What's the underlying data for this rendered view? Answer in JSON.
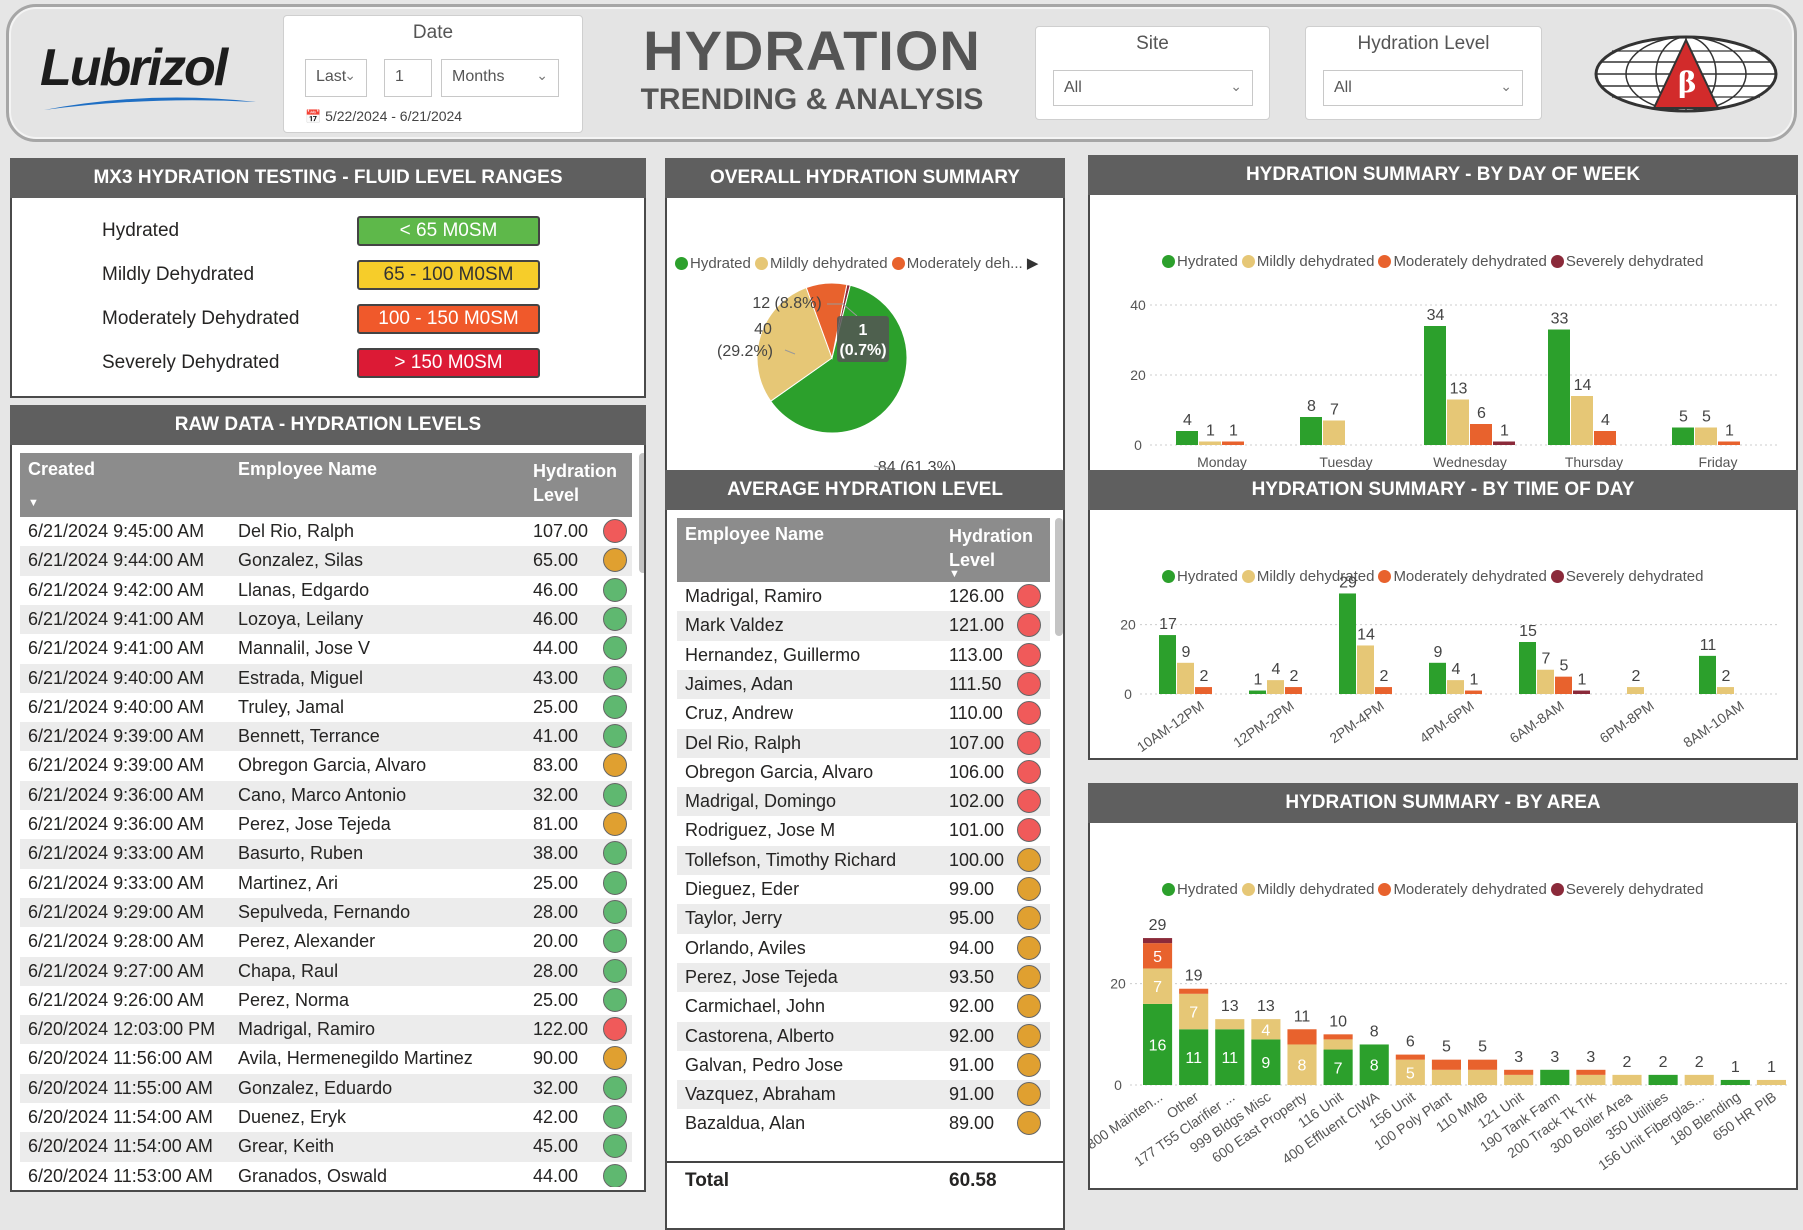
{
  "header": {
    "logo_text": "Lubrizol",
    "title": "HYDRATION",
    "subtitle": "TRENDING & ANALYSIS",
    "date_slicer": {
      "title": "Date",
      "relative": "Last",
      "count": "1",
      "unit": "Months",
      "range": "5/22/2024 - 6/21/2024"
    },
    "site_slicer": {
      "title": "Site",
      "value": "All"
    },
    "level_slicer": {
      "title": "Hydration Level",
      "value": "All"
    }
  },
  "colors": {
    "hydrated": "#2ca02c",
    "mild": "#e6c776",
    "moderate": "#e8622d",
    "severe": "#8b2a3a",
    "panel_header": "#5f5f5f"
  },
  "ranges": {
    "title": "MX3 HYDRATION TESTING - FLUID LEVEL RANGES",
    "items": [
      {
        "label": "Hydrated",
        "range": "< 65 M0SM",
        "color": "#5eb84a"
      },
      {
        "label": "Mildly Dehydrated",
        "range": "65 - 100 M0SM",
        "color": "#f6cd2a"
      },
      {
        "label": "Moderately Dehydrated",
        "range": "100 - 150 M0SM",
        "color": "#f0592b"
      },
      {
        "label": "Severely Dehydrated",
        "range": "> 150 M0SM",
        "color": "#dc1a35"
      }
    ]
  },
  "raw": {
    "title": "RAW DATA - HYDRATION LEVELS",
    "col_created": "Created",
    "col_name": "Employee Name",
    "col_level": "Hydration Level",
    "rows": [
      [
        "6/21/2024 9:45:00 AM",
        "Del Rio, Ralph",
        "107.00",
        "red"
      ],
      [
        "6/21/2024 9:44:00 AM",
        "Gonzalez, Silas",
        "65.00",
        "orange"
      ],
      [
        "6/21/2024 9:42:00 AM",
        "Llanas, Edgardo",
        "46.00",
        "green"
      ],
      [
        "6/21/2024 9:41:00 AM",
        "Lozoya, Leilany",
        "46.00",
        "green"
      ],
      [
        "6/21/2024 9:41:00 AM",
        "Mannalil, Jose V",
        "44.00",
        "green"
      ],
      [
        "6/21/2024 9:40:00 AM",
        "Estrada, Miguel",
        "43.00",
        "green"
      ],
      [
        "6/21/2024 9:40:00 AM",
        "Truley, Jamal",
        "25.00",
        "green"
      ],
      [
        "6/21/2024 9:39:00 AM",
        "Bennett, Terrance",
        "41.00",
        "green"
      ],
      [
        "6/21/2024 9:39:00 AM",
        "Obregon Garcia, Alvaro",
        "83.00",
        "orange"
      ],
      [
        "6/21/2024 9:36:00 AM",
        "Cano, Marco Antonio",
        "32.00",
        "green"
      ],
      [
        "6/21/2024 9:36:00 AM",
        "Perez, Jose Tejeda",
        "81.00",
        "orange"
      ],
      [
        "6/21/2024 9:33:00 AM",
        "Basurto, Ruben",
        "38.00",
        "green"
      ],
      [
        "6/21/2024 9:33:00 AM",
        "Martinez, Ari",
        "25.00",
        "green"
      ],
      [
        "6/21/2024 9:29:00 AM",
        "Sepulveda, Fernando",
        "28.00",
        "green"
      ],
      [
        "6/21/2024 9:28:00 AM",
        "Perez, Alexander",
        "20.00",
        "green"
      ],
      [
        "6/21/2024 9:27:00 AM",
        "Chapa, Raul",
        "28.00",
        "green"
      ],
      [
        "6/21/2024 9:26:00 AM",
        "Perez, Norma",
        "25.00",
        "green"
      ],
      [
        "6/20/2024 12:03:00 PM",
        "Madrigal, Ramiro",
        "122.00",
        "red"
      ],
      [
        "6/20/2024 11:56:00 AM",
        "Avila, Hermenegildo Martinez",
        "90.00",
        "orange"
      ],
      [
        "6/20/2024 11:55:00 AM",
        "Gonzalez, Eduardo",
        "32.00",
        "green"
      ],
      [
        "6/20/2024 11:54:00 AM",
        "Duenez, Eryk",
        "42.00",
        "green"
      ],
      [
        "6/20/2024 11:54:00 AM",
        "Grear, Keith",
        "45.00",
        "green"
      ],
      [
        "6/20/2024 11:53:00 AM",
        "Granados, Oswald",
        "44.00",
        "green"
      ]
    ]
  },
  "overall": {
    "title": "OVERALL HYDRATION SUMMARY",
    "legend": [
      "Hydrated",
      "Mildly dehydrated",
      "Moderately deh..."
    ],
    "labels": {
      "moderate": "12 (8.8%)",
      "mild_value": "40",
      "mild_pct": "(29.2%)",
      "severe_value": "1",
      "severe_pct": "(0.7%)",
      "hydrated": "84 (61.3%)"
    }
  },
  "average": {
    "title": "AVERAGE HYDRATION LEVEL",
    "col_name": "Employee Name",
    "col_level": "Hydration Level",
    "total_label": "Total",
    "total_value": "60.58",
    "rows": [
      [
        "Madrigal, Ramiro",
        "126.00",
        "red"
      ],
      [
        "Mark Valdez",
        "121.00",
        "red"
      ],
      [
        "Hernandez, Guillermo",
        "113.00",
        "red"
      ],
      [
        "Jaimes, Adan",
        "111.50",
        "red"
      ],
      [
        "Cruz, Andrew",
        "110.00",
        "red"
      ],
      [
        "Del Rio, Ralph",
        "107.00",
        "red"
      ],
      [
        "Obregon Garcia, Alvaro",
        "106.00",
        "red"
      ],
      [
        "Madrigal, Domingo",
        "102.00",
        "red"
      ],
      [
        "Rodriguez, Jose M",
        "101.00",
        "red"
      ],
      [
        "Tollefson, Timothy Richard",
        "100.00",
        "orange"
      ],
      [
        "Dieguez, Eder",
        "99.00",
        "orange"
      ],
      [
        "Taylor, Jerry",
        "95.00",
        "orange"
      ],
      [
        "Orlando, Aviles",
        "94.00",
        "orange"
      ],
      [
        "Perez, Jose Tejeda",
        "93.50",
        "orange"
      ],
      [
        "Carmichael, John",
        "92.00",
        "orange"
      ],
      [
        "Castorena, Alberto",
        "92.00",
        "orange"
      ],
      [
        "Galvan, Pedro Jose",
        "91.00",
        "orange"
      ],
      [
        "Vazquez, Abraham",
        "91.00",
        "orange"
      ],
      [
        "Bazaldua, Alan",
        "89.00",
        "orange"
      ]
    ]
  },
  "legend_full": [
    "Hydrated",
    "Mildly dehydrated",
    "Moderately dehydrated",
    "Severely dehydrated"
  ],
  "dow": {
    "title": "HYDRATION SUMMARY - BY DAY OF WEEK"
  },
  "tod": {
    "title": "HYDRATION SUMMARY - BY TIME OF DAY"
  },
  "area": {
    "title": "HYDRATION SUMMARY - BY AREA"
  },
  "chart_data": [
    {
      "type": "pie",
      "title": "OVERALL HYDRATION SUMMARY",
      "categories": [
        "Hydrated",
        "Mildly dehydrated",
        "Moderately dehydrated",
        "Severely dehydrated"
      ],
      "values": [
        84,
        40,
        12,
        1
      ]
    },
    {
      "type": "bar",
      "title": "HYDRATION SUMMARY - BY DAY OF WEEK",
      "categories": [
        "Monday",
        "Tuesday",
        "Wednesday",
        "Thursday",
        "Friday"
      ],
      "ylim": [
        0,
        40
      ],
      "yticks": [
        0,
        20,
        40
      ],
      "series": [
        {
          "name": "Hydrated",
          "values": [
            4,
            8,
            34,
            33,
            5
          ]
        },
        {
          "name": "Mildly dehydrated",
          "values": [
            1,
            7,
            13,
            14,
            5
          ]
        },
        {
          "name": "Moderately dehydrated",
          "values": [
            1,
            0,
            6,
            4,
            1
          ]
        },
        {
          "name": "Severely dehydrated",
          "values": [
            0,
            0,
            1,
            0,
            0
          ]
        }
      ]
    },
    {
      "type": "bar",
      "title": "HYDRATION SUMMARY - BY TIME OF DAY",
      "categories": [
        "10AM-12PM",
        "12PM-2PM",
        "2PM-4PM",
        "4PM-6PM",
        "6AM-8AM",
        "6PM-8PM",
        "8AM-10AM"
      ],
      "ylim": [
        0,
        30
      ],
      "yticks": [
        0,
        20
      ],
      "series": [
        {
          "name": "Hydrated",
          "values": [
            17,
            1,
            29,
            9,
            15,
            0,
            11
          ]
        },
        {
          "name": "Mildly dehydrated",
          "values": [
            9,
            4,
            14,
            4,
            7,
            2,
            2
          ]
        },
        {
          "name": "Moderately dehydrated",
          "values": [
            2,
            2,
            2,
            1,
            5,
            0,
            0
          ]
        },
        {
          "name": "Severely dehydrated",
          "values": [
            0,
            0,
            0,
            0,
            1,
            0,
            0
          ]
        }
      ]
    },
    {
      "type": "bar",
      "stacked": true,
      "title": "HYDRATION SUMMARY - BY AREA",
      "ylim": [
        0,
        30
      ],
      "yticks": [
        0,
        20
      ],
      "categories": [
        "800 Mainten...",
        "Other",
        "177 T55 Clarifier ...",
        "999 Bldgs Misc",
        "600 East Property",
        "116 Unit",
        "400 Effluent CIWA",
        "156 Unit",
        "100 Poly Plant",
        "110 MMB",
        "121 Unit",
        "190 Tank Farm",
        "200 Track Tk Trk",
        "300 Boiler Area",
        "350 Utilities",
        "156 Unit Fiberglas...",
        "180 Blending",
        "650 HR PIB"
      ],
      "totals": [
        29,
        19,
        13,
        13,
        11,
        10,
        8,
        6,
        5,
        5,
        3,
        3,
        3,
        2,
        2,
        2,
        1,
        1
      ],
      "series": [
        {
          "name": "Hydrated",
          "values": [
            16,
            11,
            11,
            9,
            0,
            7,
            8,
            0,
            0,
            0,
            0,
            3,
            0,
            0,
            2,
            0,
            1,
            0
          ]
        },
        {
          "name": "Mildly dehydrated",
          "values": [
            7,
            7,
            2,
            4,
            8,
            2,
            0,
            5,
            3,
            3,
            2,
            0,
            2,
            2,
            0,
            2,
            0,
            1
          ]
        },
        {
          "name": "Moderately dehydrated",
          "values": [
            5,
            1,
            0,
            0,
            3,
            1,
            0,
            1,
            2,
            2,
            1,
            0,
            1,
            0,
            0,
            0,
            0,
            0
          ]
        },
        {
          "name": "Severely dehydrated",
          "values": [
            1,
            0,
            0,
            0,
            0,
            0,
            0,
            0,
            0,
            0,
            0,
            0,
            0,
            0,
            0,
            0,
            0,
            0
          ]
        }
      ]
    }
  ]
}
